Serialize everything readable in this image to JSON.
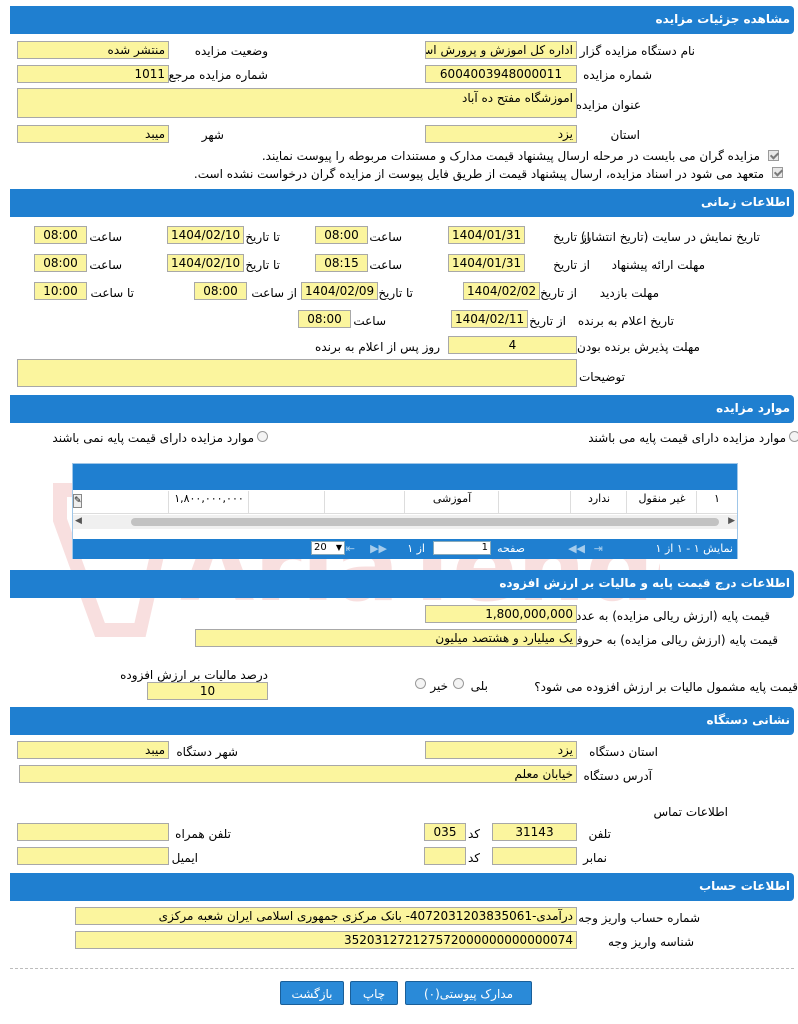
{
  "sections": {
    "details": "مشاهده جزئیات مزایده",
    "time": "اطلاعات زمانی",
    "items": "موارد مزایده",
    "price": "اطلاعات درج قیمت پایه و مالیات بر ارزش افزوده",
    "address": "نشانی دستگاه",
    "account": "اطلاعات حساب"
  },
  "details": {
    "org_label": "نام دستگاه مزایده گزار",
    "org_value": "اداره کل اموزش و پرورش اس",
    "status_label": "وضعیت مزایده",
    "status_value": "منتشر شده",
    "number_label": "شماره مزایده",
    "number_value": "6004003948000011",
    "ref_label": "شماره مزایده مرجع",
    "ref_value": "1011",
    "title_label": "عنوان مزایده",
    "title_value": "اموزشگاه مفتح ده آباد",
    "province_label": "استان",
    "province_value": "یزد",
    "city_label": "شهر",
    "city_value": "میبد",
    "check1": "مزایده گران می بایست در مرحله ارسال پیشنهاد قیمت مدارک و مستندات مربوطه را پیوست نمایند.",
    "check2": "متعهد می شود در اسناد مزایده، ارسال پیشنهاد قیمت از طریق فایل پیوست از مزایده گران درخواست نشده است."
  },
  "time": {
    "site_label": "تاریخ نمایش در سایت (تاریخ انتشار)",
    "from": "از تاریخ",
    "to": "تا تاریخ",
    "hour": "ساعت",
    "to_hour": "تا ساعت",
    "from_hour": "از ساعت",
    "site_from": "1404/01/31",
    "site_from_time": "08:00",
    "site_to": "1404/02/10",
    "site_to_time": "08:00",
    "offer_label": "مهلت ارائه پیشنهاد",
    "offer_from": "1404/01/31",
    "offer_from_time": "08:15",
    "offer_to": "1404/02/10",
    "offer_to_time": "08:00",
    "visit_label": "مهلت بازدید",
    "visit_from": "1404/02/02",
    "visit_to": "1404/02/09",
    "visit_from_time": "08:00",
    "visit_to_time": "10:00",
    "announce_label": "تاریخ اعلام به برنده",
    "announce_date": "1404/02/11",
    "announce_time": "08:00",
    "accept_label": "مهلت پذیرش برنده بودن",
    "accept_value": "4",
    "accept_suffix": "روز پس از اعلام به برنده",
    "desc_label": "توضیحات",
    "desc_value": ""
  },
  "items": {
    "radio_with": "موارد مزایده دارای قیمت پایه می باشند",
    "radio_without": "موارد مزایده دارای قیمت پایه نمی باشند",
    "row": {
      "idx": "۱",
      "type": "غیر منقول",
      "flag": "ندارد",
      "category": "آموزشی",
      "price": "۱,۸۰۰,۰۰۰,۰۰۰"
    },
    "pager_info": "نمایش ۱ - ۱ از ۱",
    "page_label": "صفحه",
    "page_value": "1",
    "of_label": "از ۱",
    "page_size": "20"
  },
  "price": {
    "base_num_label": "قیمت پایه (ارزش ریالی مزایده) به عدد",
    "base_num_value": "1,800,000,000",
    "base_txt_label": "قیمت پایه (ارزش ریالی مزایده) به حروف",
    "base_txt_value": "یک میلیارد و هشتصد میلیون",
    "vat_percent_label": "درصد مالیات بر ارزش افزوده",
    "vat_percent_value": "10",
    "vat_question": "قیمت پایه مشمول مالیات بر ارزش افزوده می شود؟",
    "yes": "بلی",
    "no": "خیر"
  },
  "address": {
    "province_label": "استان دستگاه",
    "province_value": "یزد",
    "city_label": "شهر دستگاه",
    "city_value": "میبد",
    "addr_label": "آدرس دستگاه",
    "addr_value": "خیابان معلم",
    "contact_label": "اطلاعات تماس",
    "phone_label": "تلفن",
    "phone_value": "31143",
    "code_label": "کد",
    "code_value": "035",
    "mobile_label": "تلفن همراه",
    "mobile_value": "",
    "fax_label": "نمابر",
    "fax_value": "",
    "fax_code_value": "",
    "email_label": "ایمیل",
    "email_value": ""
  },
  "account": {
    "acc_label": "شماره حساب واریز وجه",
    "acc_value": "درآمدی-4072031203835061- بانک مرکزی جمهوری اسلامی ایران شعبه مرکزی",
    "sheba_label": "شناسه واریز وجه",
    "sheba_value": "352031272127572000000000000074"
  },
  "buttons": {
    "attachments": "مدارک پیوستی(۰)",
    "print": "چاپ",
    "back": "بازگشت"
  },
  "watermark": "AriaTender.neT",
  "colors": {
    "bar": "#1f7fd0",
    "field": "#fbf59e"
  }
}
